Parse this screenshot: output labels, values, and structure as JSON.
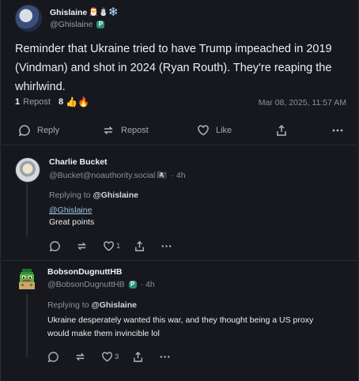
{
  "post": {
    "author": {
      "display_name": "Ghislaine",
      "name_emojis": "🎅⛄❄️",
      "handle": "@Ghislaine",
      "badge": "P"
    },
    "text": "Reminder that Ukraine tried to have Trump impeached in 2019 (Vindman) and shot in 2024 (Ryan Routh). They're reaping the whirlwind.",
    "repost_count": "1",
    "repost_label": "Repost",
    "reaction_count": "8",
    "reaction_emojis": "👍🔥",
    "timestamp": "Mar 08, 2025, 11:57 AM",
    "actions": {
      "reply": "Reply",
      "repost": "Repost",
      "like": "Like"
    }
  },
  "replies": [
    {
      "display_name": "Charlie Bucket",
      "handle": "@Bucket@noauthority.social",
      "handle_suffix": "🏴‍☠️",
      "time": "· 4h",
      "replying_label": "Replying to",
      "replying_to": "@Ghislaine",
      "mention": "@Ghislaine",
      "text": "Great points",
      "reply_count": "",
      "repost_count": "",
      "like_count": "1"
    },
    {
      "display_name": "BobsonDugnuttHB",
      "handle": "@BobsonDugnuttHB",
      "badge": "P",
      "time": "· 4h",
      "replying_label": "Replying to",
      "replying_to": "@Ghislaine",
      "text": "Ukraine desperately wanted this war, and they thought being a US proxy would make them invincible lol",
      "reply_count": "",
      "repost_count": "",
      "like_count": "3"
    }
  ],
  "icons": {
    "reply": "reply-bubble-icon",
    "repost": "repost-arrows-icon",
    "like": "heart-icon",
    "share": "share-upload-icon",
    "more": "more-dots-icon"
  },
  "colors": {
    "background": "#16181d",
    "mention": "#9fc4e8",
    "badge": "#2c8f7a"
  }
}
